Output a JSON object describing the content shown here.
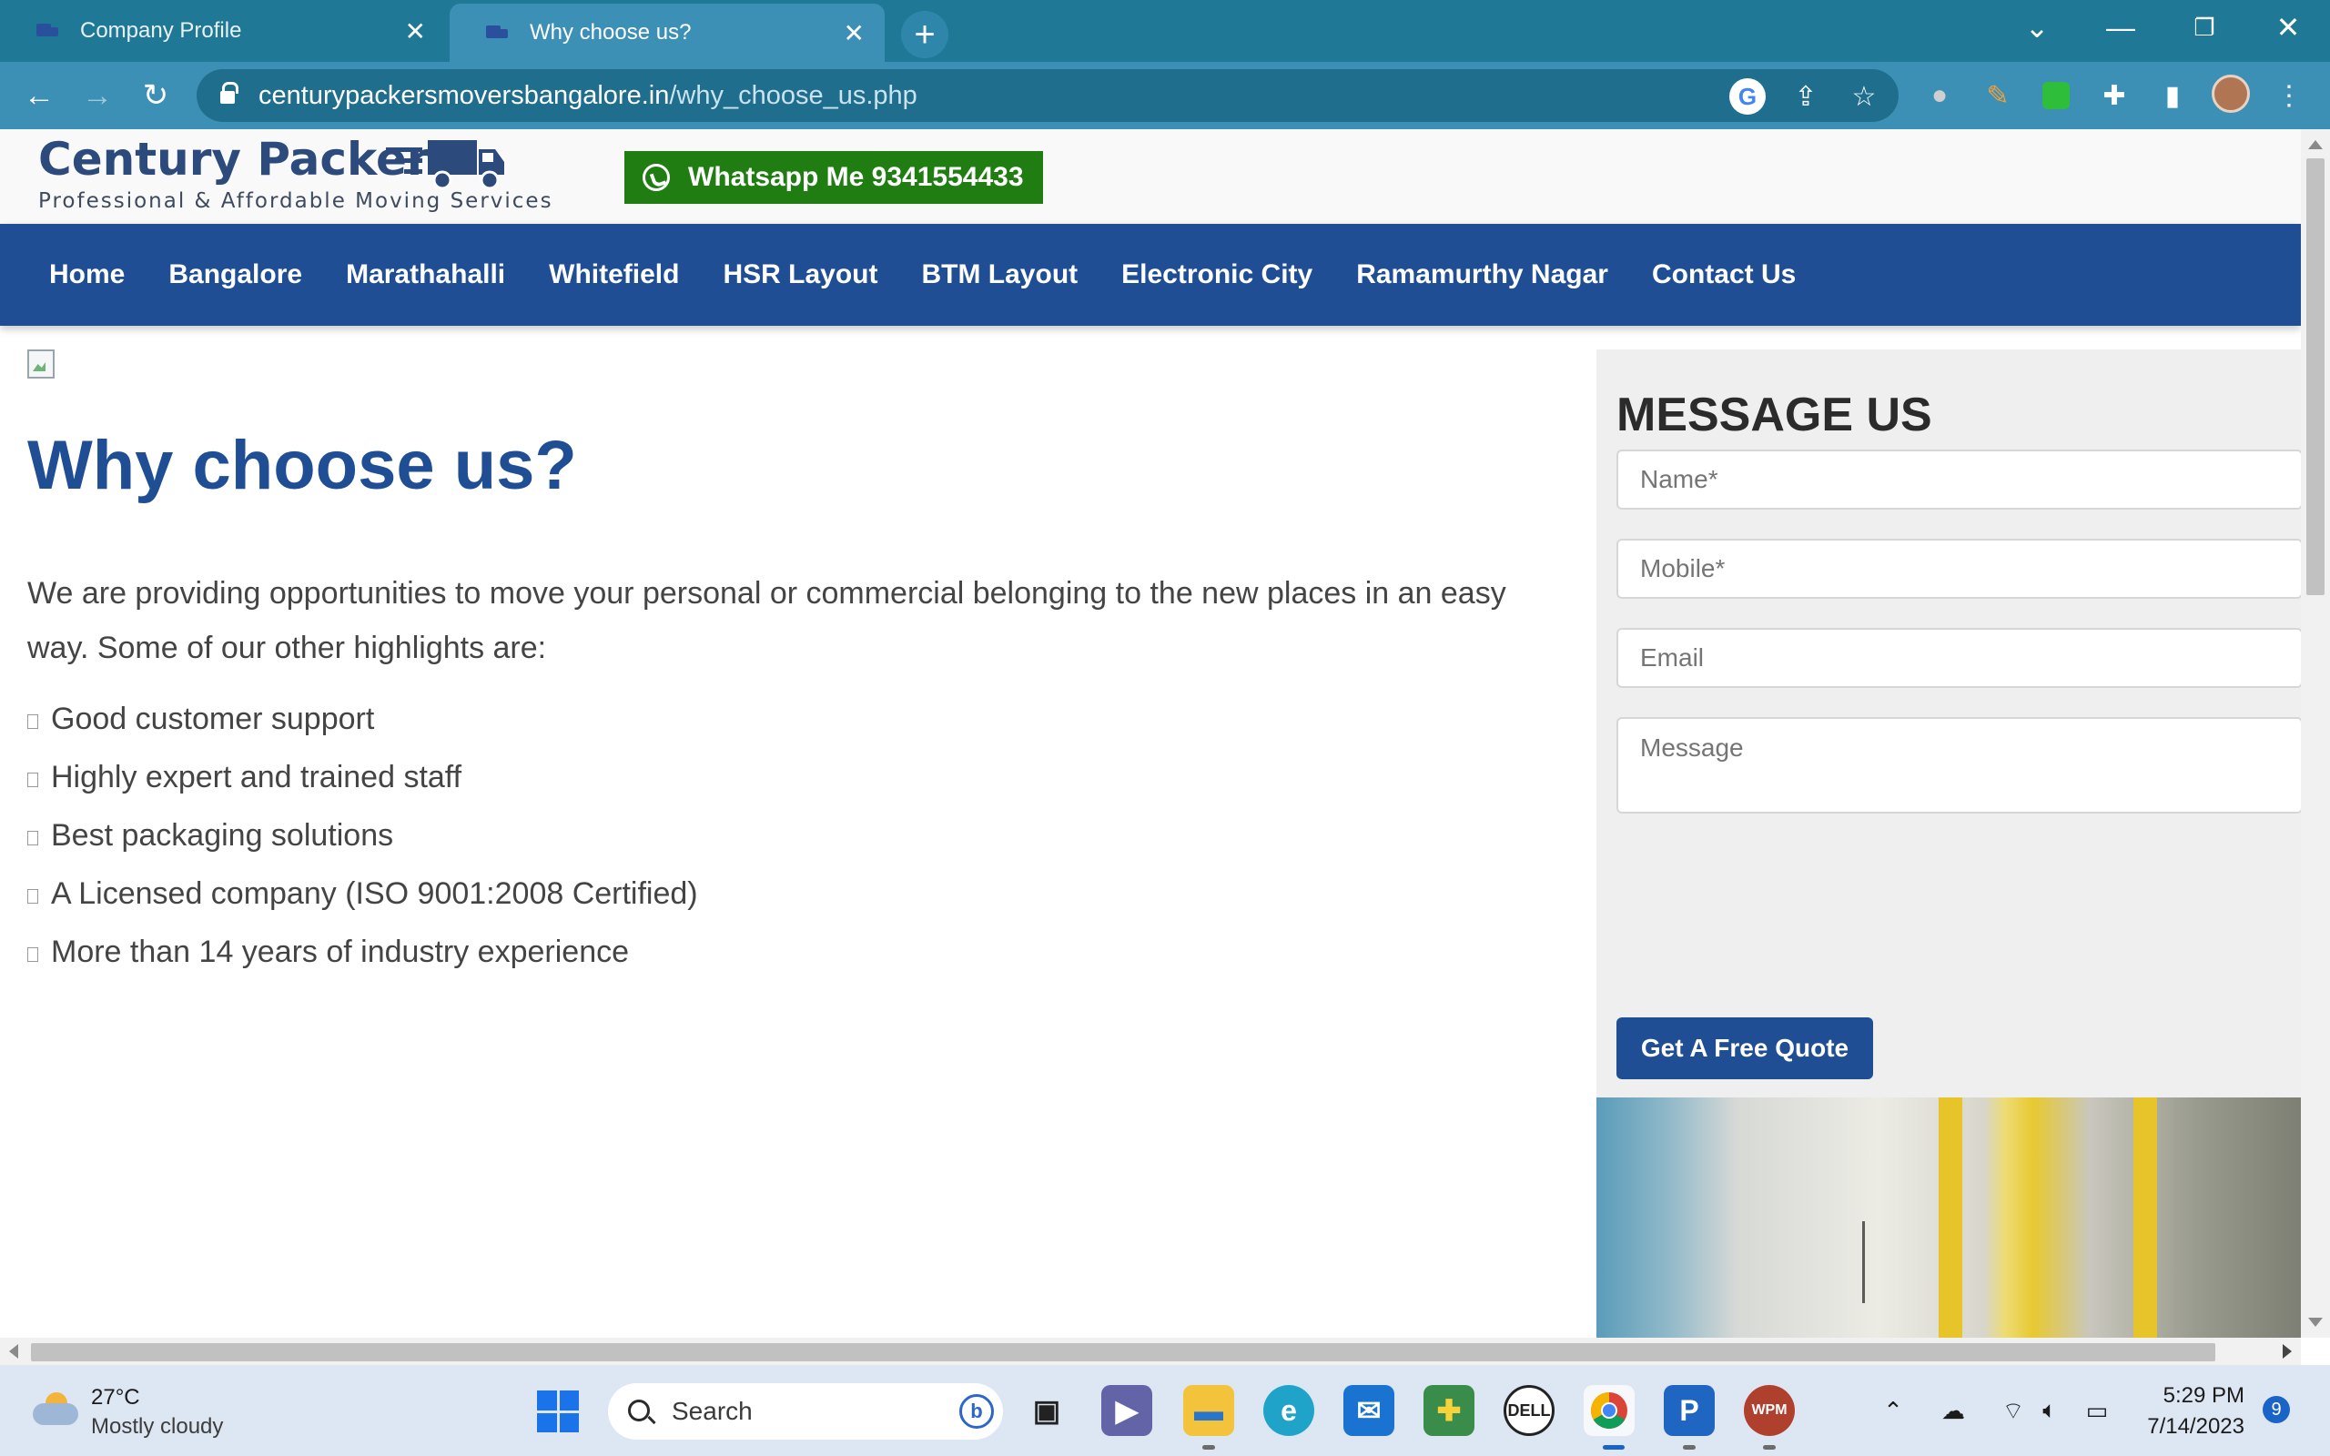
{
  "browser": {
    "tabs": [
      {
        "title": "Company Profile",
        "active": false
      },
      {
        "title": "Why choose us?",
        "active": true
      }
    ],
    "new_tab_icon": "plus-icon",
    "window_controls": [
      "chevron-down-icon",
      "minimize-icon",
      "restore-icon",
      "close-icon"
    ],
    "url_host": "centurypackersmoversbangalore.in",
    "url_path": "/why_choose_us.php",
    "accent_color": "#3d90b5",
    "tabbar_color": "#1e7896"
  },
  "site": {
    "logo_title": "Century Packers",
    "logo_tagline": "Professional & Affordable Moving Services",
    "whatsapp_label": "Whatsapp Me 9341554433",
    "whatsapp_color": "#1f7d12",
    "nav_color": "#1f4e94",
    "nav": [
      "Home",
      "Bangalore",
      "Marathahalli",
      "Whitefield",
      "HSR Layout",
      "BTM Layout",
      "Electronic City",
      "Ramamurthy Nagar",
      "Contact Us"
    ]
  },
  "main": {
    "title": "Why choose us?",
    "intro": "We are providing opportunities to move your personal or commercial belonging to the new places in an easy way. Some of our other highlights are:",
    "highlights": [
      "Good customer support",
      "Highly expert and trained staff",
      "Best packaging solutions",
      "A Licensed company (ISO 9001:2008 Certified)",
      "More than 14 years of industry experience"
    ]
  },
  "sidebar": {
    "title": "MESSAGE US",
    "name_placeholder": "Name*",
    "mobile_placeholder": "Mobile*",
    "email_placeholder": "Email",
    "message_placeholder": "Message",
    "submit_label": "Get A Free Quote"
  },
  "taskbar": {
    "temperature": "27°C",
    "weather": "Mostly cloudy",
    "search_placeholder": "Search",
    "time": "5:29 PM",
    "date": "7/14/2023",
    "notification_count": "9",
    "apps": [
      "task-view-icon",
      "teams-icon",
      "file-explorer-icon",
      "edge-icon",
      "mail-icon",
      "app-plus-icon",
      "dell-icon",
      "chrome-icon",
      "app-p-icon",
      "wpm-icon"
    ]
  }
}
